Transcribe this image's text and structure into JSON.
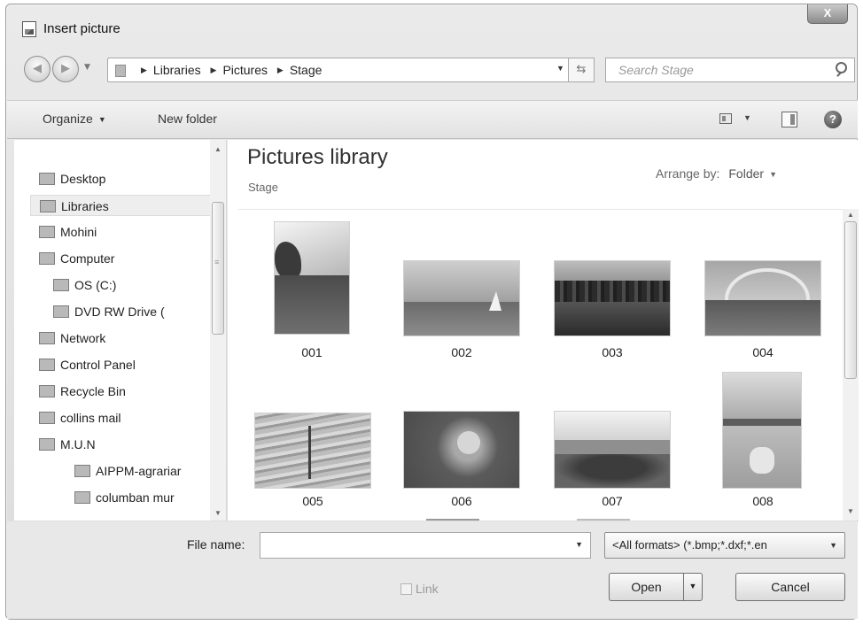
{
  "window": {
    "title": "Insert picture",
    "close_label": "X"
  },
  "address": {
    "crumbs": [
      "Libraries",
      "Pictures",
      "Stage"
    ],
    "search_placeholder": "Search Stage"
  },
  "toolbar": {
    "organize_label": "Organize",
    "new_folder_label": "New folder",
    "help_label": "?"
  },
  "nav": {
    "items": [
      {
        "label": "Desktop",
        "icon": "desktop-icon"
      },
      {
        "label": "Libraries",
        "icon": "libraries-icon",
        "selected": true
      },
      {
        "label": "Mohini",
        "icon": "user-icon"
      },
      {
        "label": "Computer",
        "icon": "computer-icon"
      },
      {
        "label": "OS (C:)",
        "icon": "drive-icon"
      },
      {
        "label": "DVD RW Drive (",
        "icon": "dvd-drive-icon"
      },
      {
        "label": "Network",
        "icon": "network-icon"
      },
      {
        "label": "Control Panel",
        "icon": "control-panel-icon"
      },
      {
        "label": "Recycle Bin",
        "icon": "recycle-bin-icon"
      },
      {
        "label": "collins mail",
        "icon": "folder-icon"
      },
      {
        "label": "M.U.N",
        "icon": "folder-icon"
      },
      {
        "label": "AIPPM-agrariar",
        "icon": "folder-icon"
      },
      {
        "label": "columban mur",
        "icon": "folder-icon"
      }
    ]
  },
  "content": {
    "library_title": "Pictures library",
    "library_subtitle": "Stage",
    "arrange_label": "Arrange by:",
    "arrange_value": "Folder",
    "files": [
      {
        "name": "001",
        "scene": "park-tree-portrait"
      },
      {
        "name": "002",
        "scene": "lake-sailboat"
      },
      {
        "name": "003",
        "scene": "city-skyline-reflection"
      },
      {
        "name": "004",
        "scene": "arch-bridge"
      },
      {
        "name": "005",
        "scene": "snowy-riverbank"
      },
      {
        "name": "006",
        "scene": "flower-closeup"
      },
      {
        "name": "007",
        "scene": "bushes-and-wall"
      },
      {
        "name": "008",
        "scene": "field-portrait"
      }
    ]
  },
  "footer": {
    "file_name_label": "File name:",
    "file_name_value": "",
    "filter_value": "<All formats> (*.bmp;*.dxf;*.en",
    "link_label": "Link",
    "open_label": "Open",
    "cancel_label": "Cancel"
  }
}
